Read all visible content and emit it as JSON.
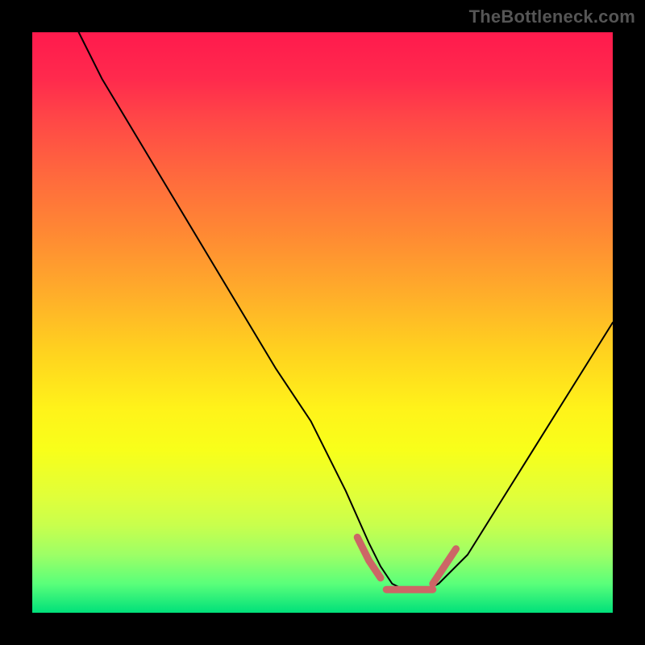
{
  "watermark": "TheBottleneck.com",
  "chart_data": {
    "type": "line",
    "title": "",
    "xlabel": "",
    "ylabel": "",
    "xlim": [
      0,
      100
    ],
    "ylim": [
      0,
      100
    ],
    "grid": false,
    "legend": false,
    "background": {
      "gradient_axis": "vertical",
      "top_color": "#ff1a4d",
      "bottom_color": "#00e07a",
      "meaning": "high (red) to low (green) bottleneck"
    },
    "series": [
      {
        "name": "bottleneck-curve",
        "color": "#000000",
        "stroke_width": 2,
        "x": [
          8,
          12,
          18,
          24,
          30,
          36,
          42,
          48,
          54,
          58,
          60,
          62,
          64,
          66,
          68,
          70,
          75,
          80,
          85,
          90,
          95,
          100
        ],
        "y": [
          100,
          92,
          82,
          72,
          62,
          52,
          42,
          33,
          21,
          12,
          8,
          5,
          4,
          4,
          4,
          5,
          10,
          18,
          26,
          34,
          42,
          50
        ]
      },
      {
        "name": "optimal-band",
        "color": "#cc6666",
        "stroke_width": 9,
        "segments": [
          {
            "x": [
              56,
              58,
              60
            ],
            "y": [
              13,
              9,
              6
            ]
          },
          {
            "x": [
              61,
              63,
              65,
              67,
              69
            ],
            "y": [
              4,
              4,
              4,
              4,
              4
            ]
          },
          {
            "x": [
              69,
              71,
              73
            ],
            "y": [
              5,
              8,
              11
            ]
          }
        ]
      }
    ],
    "annotations": []
  }
}
